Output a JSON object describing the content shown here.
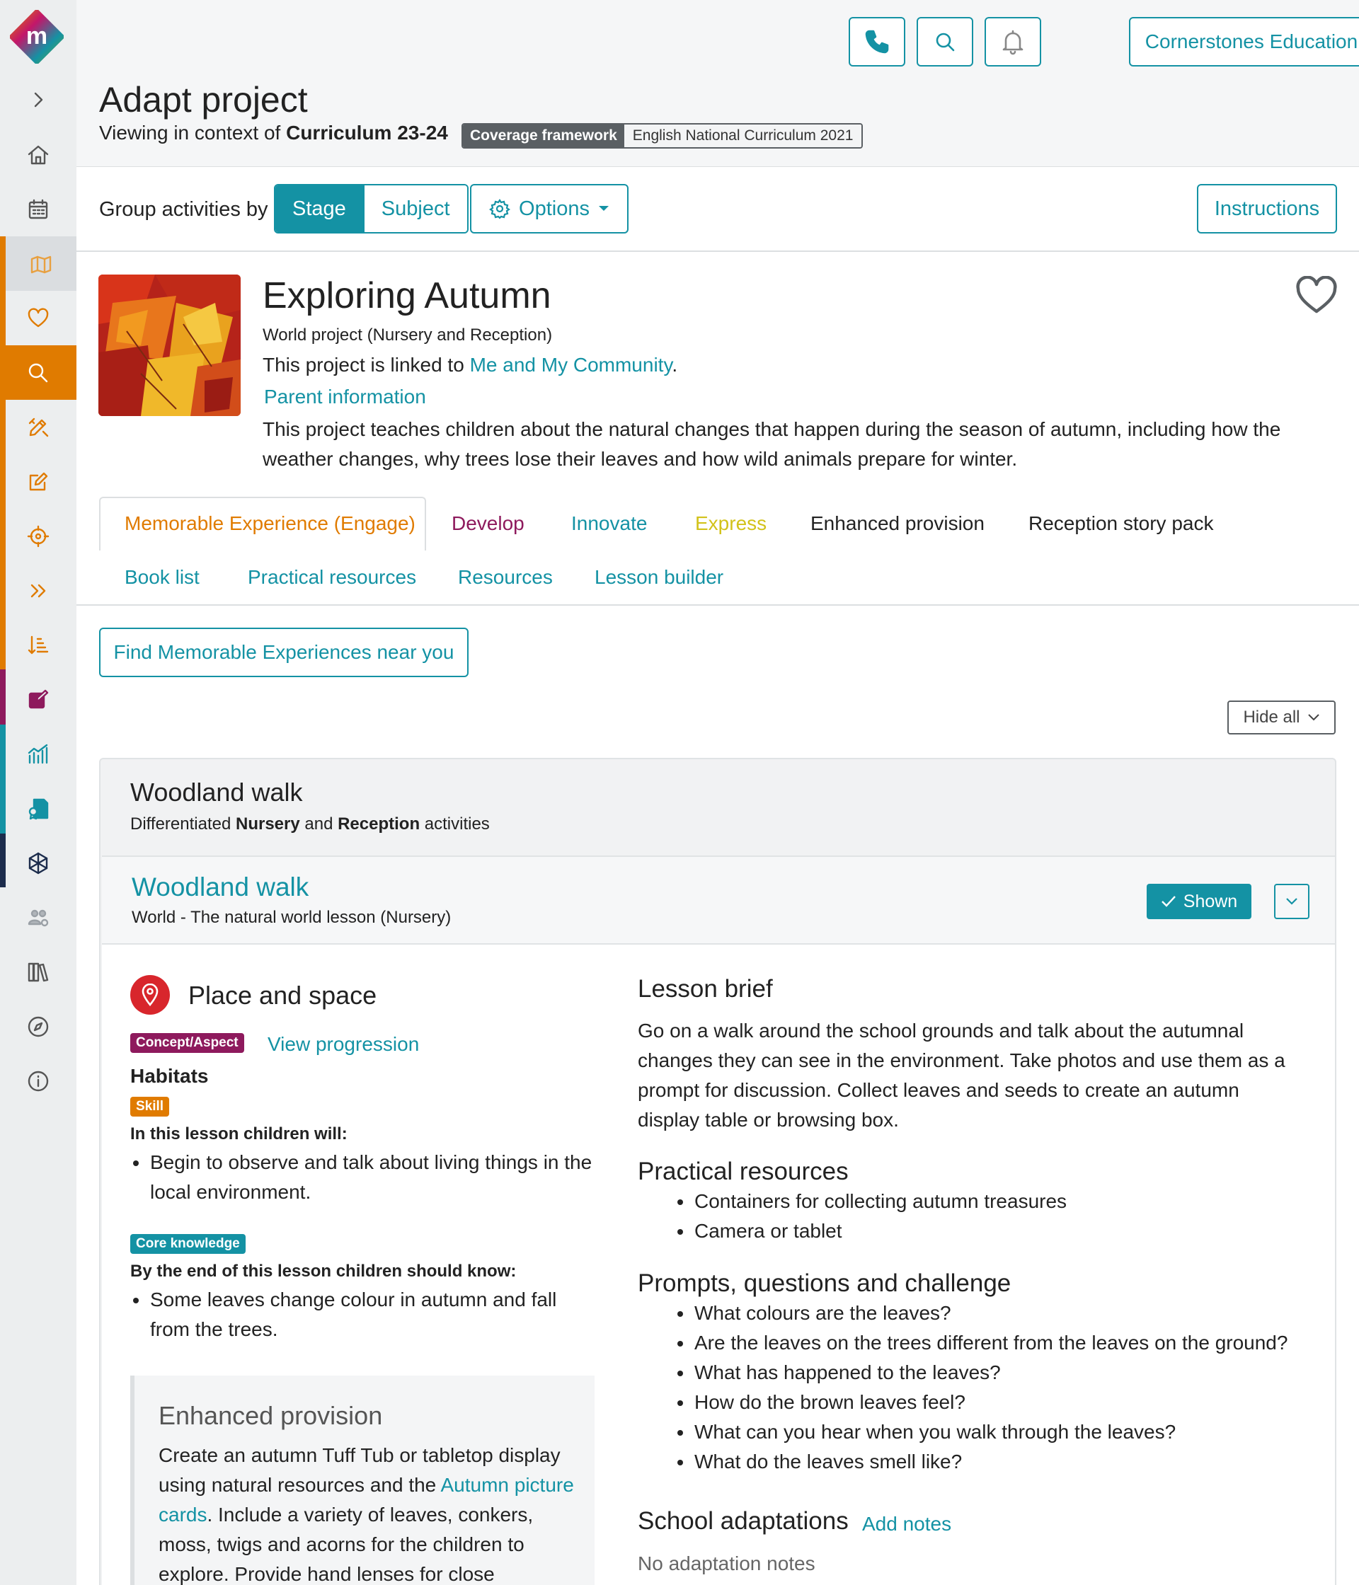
{
  "header": {
    "org_name": "Cornerstones Education",
    "page_title": "Adapt project",
    "context_prefix": "Viewing in context of ",
    "context_value": "Curriculum 23-24",
    "coverage_label": "Coverage framework",
    "coverage_value": "English National Curriculum 2021"
  },
  "toolbar": {
    "group_label": "Group activities by",
    "group_options": [
      "Stage",
      "Subject"
    ],
    "selected": "Stage",
    "options_label": "Options",
    "instructions_label": "Instructions"
  },
  "project": {
    "title": "Exploring Autumn",
    "subtitle": "World project (Nursery and Reception)",
    "linked_prefix": "This project is linked to ",
    "linked_link": "Me and My Community",
    "linked_suffix": ".",
    "parent_info": "Parent information",
    "description": "This project teaches children about the natural changes that happen during the season of autumn, including how the weather changes, why trees lose their leaves and how wild animals prepare for winter."
  },
  "tabs": {
    "row1": [
      {
        "label": "Memorable Experience (Engage)",
        "color": "#e07b00"
      },
      {
        "label": "Develop",
        "color": "#8e1a5d"
      },
      {
        "label": "Innovate",
        "color": "#1492a4"
      },
      {
        "label": "Express",
        "color": "#d2c21a"
      },
      {
        "label": "Enhanced provision",
        "color": "#222222"
      },
      {
        "label": "Reception story pack",
        "color": "#222222"
      }
    ],
    "row2": [
      "Book list",
      "Practical resources",
      "Resources",
      "Lesson builder"
    ]
  },
  "find_button": "Find Memorable Experiences near you",
  "hide_all": "Hide all",
  "group": {
    "title": "Woodland walk",
    "sub_prefix": "Differentiated ",
    "sub_nursery": "Nursery",
    "sub_and": " and ",
    "sub_reception": "Reception",
    "sub_suffix": " activities"
  },
  "lesson": {
    "title": "Woodland walk",
    "subtitle": "World - The natural world lesson (Nursery)",
    "shown_label": "Shown",
    "place_title": "Place and space",
    "concept_badge": "Concept/Aspect",
    "view_progression": "View progression",
    "concept_value": "Habitats",
    "skill_badge": "Skill",
    "skill_intro": "In this lesson children will:",
    "skill_items": [
      "Begin to observe and talk about living things in the local environment."
    ],
    "core_badge": "Core knowledge",
    "core_intro": "By the end of this lesson children should know:",
    "core_items": [
      "Some leaves change colour in autumn and fall from the trees."
    ],
    "enhanced_title": "Enhanced provision",
    "enhanced_text_1": "Create an autumn Tuff Tub or tabletop display using natural resources and the ",
    "enhanced_link": "Autumn picture cards",
    "enhanced_text_2": ". Include a variety of leaves, conkers, moss, twigs and acorns for the children to explore. Provide hand lenses for close",
    "brief_title": "Lesson brief",
    "brief_text": "Go on a walk around the school grounds and talk about the autumnal changes they can see in the environment. Take photos and use them as a prompt for discussion. Collect leaves and seeds to create an autumn display table or browsing box.",
    "practical_title": "Practical resources",
    "practical_items": [
      "Containers for collecting autumn treasures",
      "Camera or tablet"
    ],
    "prompts_title": "Prompts, questions and challenge",
    "prompts_items": [
      "What colours are the leaves?",
      "Are the leaves on the trees different from the leaves on the ground?",
      "What has happened to the leaves?",
      "How do the brown leaves feel?",
      "What can you hear when you walk through the leaves?",
      "What do the leaves smell like?"
    ],
    "adapt_title": "School adaptations",
    "add_notes": "Add notes",
    "no_notes": "No adaptation notes"
  },
  "sidebar": {
    "icons": [
      "logo-icon",
      "expand-icon",
      "home-icon",
      "calendar-icon",
      "map-icon",
      "heart-icon",
      "search-icon",
      "pencil-ruler-icon",
      "edit-icon",
      "target-icon",
      "chevrons-icon",
      "sort-icon",
      "edit-icon",
      "chart-icon",
      "certificate-icon",
      "network-icon",
      "users-icon",
      "library-icon",
      "compass-icon",
      "info-icon"
    ]
  },
  "colors": {
    "accent": "#1492a4",
    "orange": "#e07b00",
    "magenta": "#8e1a5d",
    "navy": "#1c2c4c",
    "red": "#d8262c"
  }
}
